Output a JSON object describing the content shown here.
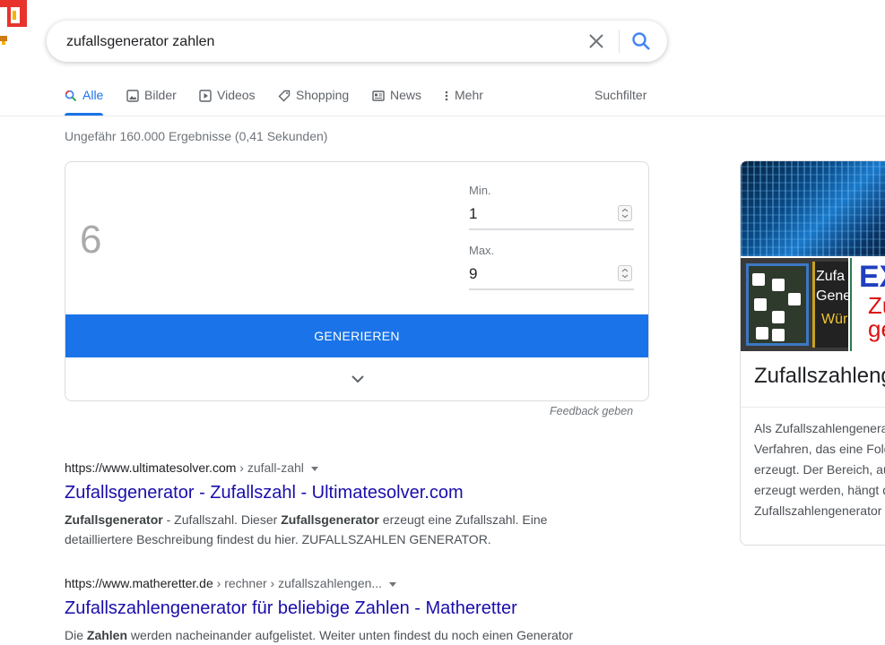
{
  "search": {
    "query": "zufallsgenerator zahlen"
  },
  "tabs": [
    {
      "label": "Alle",
      "icon": "search-icon",
      "active": true
    },
    {
      "label": "Bilder",
      "icon": "image-icon"
    },
    {
      "label": "Videos",
      "icon": "play-icon"
    },
    {
      "label": "Shopping",
      "icon": "tag-icon"
    },
    {
      "label": "News",
      "icon": "news-icon"
    },
    {
      "label": "Mehr",
      "icon": "more-vert-icon"
    }
  ],
  "tools_label": "Suchfilter",
  "results_count": "Ungefähr 160.000 Ergebnisse (0,41 Sekunden)",
  "rng": {
    "value": "6",
    "min_label": "Min.",
    "min_value": "1",
    "max_label": "Max.",
    "max_value": "9",
    "generate_label": "GENERIEREN"
  },
  "feedback_label": "Feedback geben",
  "results": [
    {
      "domain": "https://www.ultimatesolver.com",
      "path": " › zufall-zahl",
      "title": "Zufallsgenerator - Zufallszahl - Ultimatesolver.com",
      "snippet_html": "<b>Zufallsgenerator</b> - Zufallszahl. Dieser <b>Zufallsgenerator</b> erzeugt eine Zufallszahl. Eine detailliertere Beschreibung findest du hier. ZUFALLSZAHLEN GENERATOR."
    },
    {
      "domain": "https://www.matheretter.de",
      "path": " › rechner › zufallszahlengen...",
      "title": "Zufallszahlengenerator für beliebige Zahlen - Matheretter",
      "snippet_html": "Die <b>Zahlen</b> werden nacheinander aufgelistet. Weiter unten findest du noch einen Generator"
    }
  ],
  "knowledge_panel": {
    "title": "Zufallszahlengenerator",
    "description": "Als Zufallszahlengenerator bezeichnet man ein Verfahren, das eine Folge von Zufallszahlen erzeugt. Der Bereich, aus dem die Zufallszahlen erzeugt werden, hängt dabei vom speziellen Zufallszahlengenerator ab.",
    "img2_text1": "Zufa",
    "img2_text2": "Gene",
    "img2_text3": "Wür",
    "img3_text1": "EX",
    "img3_text2": "Zu",
    "img3_text3": "ge"
  },
  "colors": {
    "accent": "#1a73e8",
    "link": "#1a0dab"
  }
}
